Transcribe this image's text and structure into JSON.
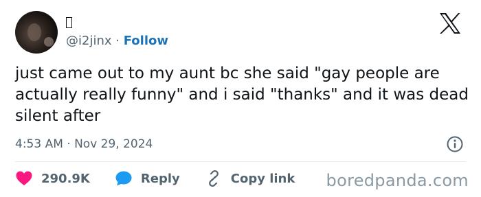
{
  "author": {
    "handle": "@i2jinx",
    "separator": "·",
    "follow_label": "Follow"
  },
  "tweet": {
    "text": "just came out to my aunt bc she said \"gay people are actually really funny\" and i said \"thanks\" and it was dead silent after",
    "timestamp": "4:53 AM · Nov 29, 2024"
  },
  "actions": {
    "likes": "290.9K",
    "reply_label": "Reply",
    "copy_link_label": "Copy link"
  },
  "watermark": "boredpanda.com",
  "colors": {
    "like": "#f91880",
    "reply": "#1d9bf0",
    "follow": "#1d73b6",
    "muted": "#536471"
  },
  "icons": [
    "x-logo-icon",
    "heart-icon",
    "speech-bubble-icon",
    "link-icon",
    "info-icon"
  ]
}
